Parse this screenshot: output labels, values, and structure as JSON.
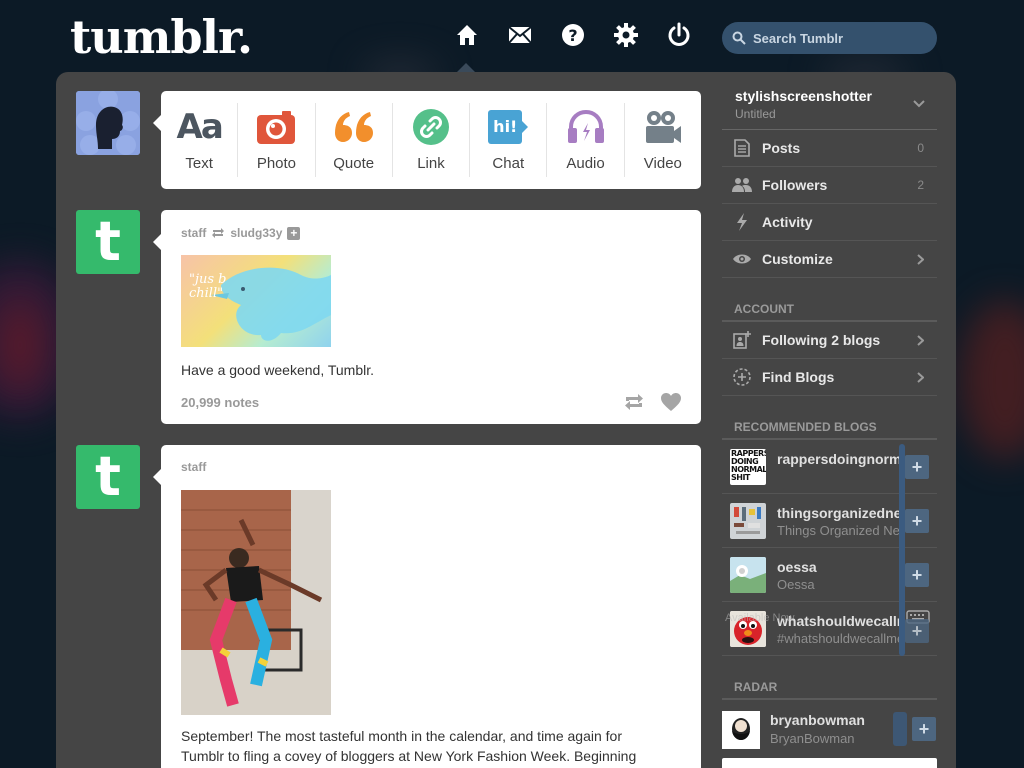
{
  "header": {
    "logo": "tumblr.",
    "search_placeholder": "Search Tumblr"
  },
  "post_types": [
    {
      "label": "Text",
      "glyph": "Aa"
    },
    {
      "label": "Photo"
    },
    {
      "label": "Quote",
      "glyph": "66"
    },
    {
      "label": "Link"
    },
    {
      "label": "Chat",
      "glyph": "hi!"
    },
    {
      "label": "Audio"
    },
    {
      "label": "Video"
    }
  ],
  "posts": [
    {
      "author": "staff",
      "reblogged_from": "sludg33y",
      "image_caption": "\"jus b chill\"",
      "text": "Have a good weekend, Tumblr.",
      "notes": "20,999 notes"
    },
    {
      "author": "staff",
      "text_line1": "September! The most tasteful month in the calendar, and time again for",
      "text_line2": "Tumblr to fling a covey of bloggers at New York Fashion Week. Beginning"
    }
  ],
  "sidebar": {
    "blog_name": "stylishscreenshotter",
    "blog_title": "Untitled",
    "menu": [
      {
        "label": "Posts",
        "count": "0"
      },
      {
        "label": "Followers",
        "count": "2"
      },
      {
        "label": "Activity"
      },
      {
        "label": "Customize"
      }
    ],
    "account_heading": "ACCOUNT",
    "account_items": [
      {
        "label": "Following 2 blogs"
      },
      {
        "label": "Find Blogs"
      }
    ],
    "recommended_heading": "RECOMMENDED BLOGS",
    "recommended": [
      {
        "name": "rappersdoingnormalshit",
        "sub": "",
        "thumb_text": "RAPPERS DOING NORMAL SHIT"
      },
      {
        "name": "thingsorganizedneatly",
        "sub": "Things Organized Neatly"
      },
      {
        "name": "oessa",
        "sub": "Oessa"
      },
      {
        "name": "whatshouldwecallme",
        "sub": "#whatshouldwecallme"
      }
    ],
    "overlay_text": "Available Now",
    "radar_heading": "RADAR",
    "radar": {
      "name": "bryanbowman",
      "sub": "BryanBowman"
    }
  },
  "colors": {
    "background": "#0c1a26",
    "panel": "#454545",
    "tumblr_green": "#35ba6c",
    "search_bg": "#34516d",
    "text_icon": "#4c5660",
    "photo_icon": "#e0563b",
    "quote_icon": "#f28f2c",
    "link_icon": "#55c08a",
    "chat_icon": "#49a3d4",
    "audio_icon": "#a77dc2",
    "video_icon": "#748089"
  }
}
